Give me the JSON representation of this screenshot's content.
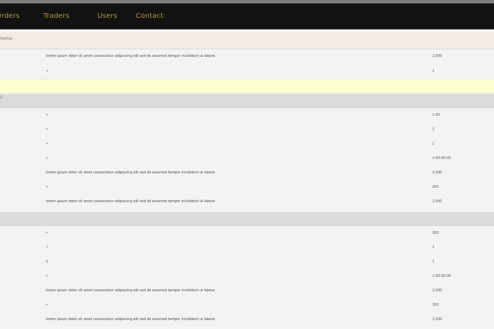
{
  "nav": {
    "items": [
      {
        "label": "Orders"
      },
      {
        "label": "Traders"
      },
      {
        "label": "Users"
      },
      {
        "label": "Contact"
      }
    ]
  },
  "breadcrumb": {
    "text": "Home"
  },
  "sections": {
    "top": {
      "rows": [
        {
          "text": "lorem ipsum dolor sit amet consectetur adipiscing elit sed do eiusmod tempor incididunt ut labore",
          "value": "2,000"
        },
        {
          "text": "•",
          "value": "1"
        }
      ]
    },
    "yellow": {
      "text": ""
    },
    "group1": {
      "header": "1",
      "rows": [
        {
          "text": "•",
          "value": "1:00"
        },
        {
          "text": "•",
          "value": "1"
        },
        {
          "text": "•",
          "value": "1"
        },
        {
          "text": "•",
          "value": "1:00:00:00"
        },
        {
          "text": "lorem ipsum dolor sit amet consectetur adipiscing elit sed do eiusmod tempor incididunt ut labore",
          "value": "2,000"
        },
        {
          "text": "•",
          "value": "200"
        },
        {
          "text": "lorem ipsum dolor sit amet consectetur adipiscing elit sed do eiusmod tempor incididunt ut labore",
          "value": "2,000"
        }
      ]
    },
    "group2": {
      "header": "",
      "rows": [
        {
          "text": "•",
          "value": "200"
        },
        {
          "text": "•",
          "value": "1"
        },
        {
          "text": "1",
          "value": "1"
        },
        {
          "text": "•",
          "value": "1:00:00:00"
        },
        {
          "text": "lorem ipsum dolor sit amet consectetur adipiscing elit sed do eiusmod tempor incididunt ut labore",
          "value": "2,000"
        },
        {
          "text": "•",
          "value": "200"
        },
        {
          "text": "lorem ipsum dolor sit amet consectetur adipiscing elit sed do eiusmod tempor incididunt ut labore",
          "value": "2,000"
        }
      ]
    }
  }
}
